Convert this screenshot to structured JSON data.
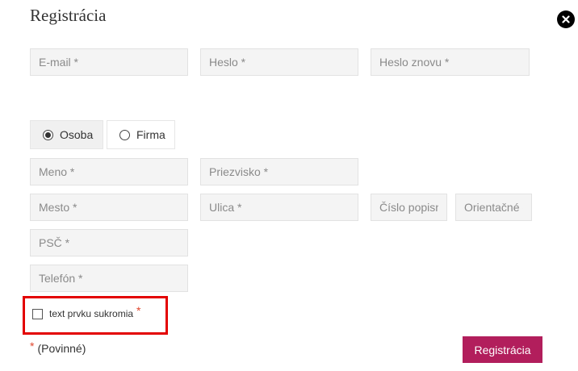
{
  "modal": {
    "title": "Registrácia"
  },
  "account": {
    "email_placeholder": "E-mail *",
    "password_placeholder": "Heslo *",
    "password_repeat_placeholder": "Heslo znovu *"
  },
  "type_selector": {
    "options": [
      {
        "label": "Osoba",
        "selected": true
      },
      {
        "label": "Firma",
        "selected": false
      }
    ]
  },
  "personal": {
    "first_name_placeholder": "Meno *",
    "last_name_placeholder": "Priezvisko *",
    "city_placeholder": "Mesto *",
    "street_placeholder": "Ulica *",
    "house_number_placeholder": "Číslo popisné",
    "orientation_number_placeholder": "Orientačné číslo",
    "zip_placeholder": "PSČ *",
    "phone_placeholder": "Telefón *"
  },
  "privacy": {
    "label": "text prvku sukromia",
    "required_mark": "*",
    "checked": false
  },
  "footer": {
    "required_mark": "*",
    "required_note": "(Povinné)",
    "submit_label": "Registrácia"
  },
  "colors": {
    "accent": "#b21e5c",
    "highlight_border": "#e30000",
    "required_star": "#e0472e",
    "field_background": "#f4f4f4"
  },
  "icons": {
    "close": "close-icon"
  }
}
